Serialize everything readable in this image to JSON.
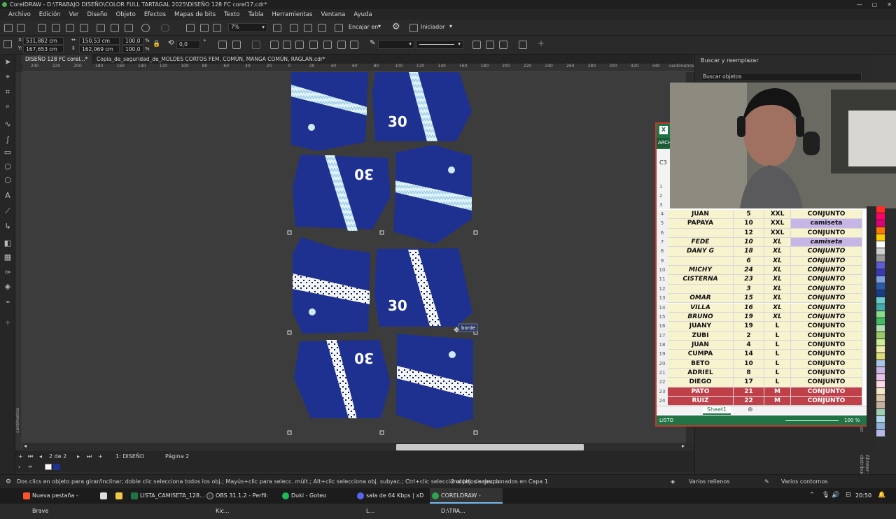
{
  "window": {
    "title": "CorelDRAW - D:\\TRABAJO DISEÑO\\COLOR FULL TARTAGAL 2025\\DISEÑO 128 FC corel17.cdr*"
  },
  "menu": [
    "Archivo",
    "Edición",
    "Ver",
    "Diseño",
    "Objeto",
    "Efectos",
    "Mapas de bits",
    "Texto",
    "Tabla",
    "Herramientas",
    "Ventana",
    "Ayuda"
  ],
  "toolbar": {
    "zoom": "7%",
    "snap": "Encajar en",
    "launcher": "Iniciador"
  },
  "propbar": {
    "x": "531,882 cm",
    "y": "167,653 cm",
    "w": "150,53 cm",
    "h": "162,069 cm",
    "sx": "100,0",
    "sy": "100,0",
    "pct": "%",
    "angle": "0,0"
  },
  "tabs": [
    {
      "label": "DISEÑO 128 FC corel...*"
    },
    {
      "label": "Copia_de_seguridad_de_MOLDES CORTOS FEM, COMÚN, MANGA COMÚN, RAGLAN.cdr*"
    }
  ],
  "ruler": {
    "unit": "centímetros",
    "ticks": [
      "240",
      "220",
      "200",
      "180",
      "160",
      "140",
      "120",
      "100",
      "80",
      "60",
      "40",
      "20",
      "0",
      "20",
      "40",
      "60",
      "80",
      "100",
      "120",
      "140",
      "160",
      "180",
      "200",
      "220",
      "240",
      "260",
      "280",
      "300",
      "320",
      "340"
    ],
    "vunit": "centímetros"
  },
  "canvas": {
    "numbers": [
      "30",
      "30",
      "30",
      "30"
    ],
    "tooltip": "borde"
  },
  "pagenav": {
    "count": "2 de 2",
    "page1": "1: DISEÑO",
    "page2": "Página 2"
  },
  "status": {
    "hint": "Dos clics en objeto para girar/inclinar; doble clic selecciona todos los obj.; Mayús+clic para selecc. múlt.; Alt+clic selecciona obj. subyac.; Ctrl+clic selecciona obj. de grupo",
    "selection": "2 objetos seleccionados en Capa 1",
    "fill": "Varios rellenos",
    "outline": "Varios contornos"
  },
  "docker": {
    "title": "Buscar y reemplazar",
    "search": "Buscar objetos",
    "vtab1": "Transformar",
    "vtab2": "Alinear y distribuir"
  },
  "excel": {
    "file_tab": "ARCH",
    "cell_ref": "C3",
    "sheet": "Sheet1",
    "status": "LISTO",
    "zoom": "100 %",
    "empty_rows": [
      "1",
      "2",
      "3"
    ],
    "rows": [
      {
        "n": "4",
        "name": "JUAN",
        "num": "5",
        "size": "XXL",
        "type": "CONJUNTO",
        "italic": false,
        "hl": ""
      },
      {
        "n": "5",
        "name": "PAPAYA",
        "num": "10",
        "size": "XXL",
        "type": "camiseta",
        "italic": false,
        "hl": "lav"
      },
      {
        "n": "6",
        "name": "",
        "num": "12",
        "size": "XXL",
        "type": "CONJUNTO",
        "italic": false,
        "hl": ""
      },
      {
        "n": "7",
        "name": "FEDE",
        "num": "10",
        "size": "XL",
        "type": "camiseta",
        "italic": true,
        "hl": "lav"
      },
      {
        "n": "8",
        "name": "DANY G",
        "num": "18",
        "size": "XL",
        "type": "CONJUNTO",
        "italic": true,
        "hl": ""
      },
      {
        "n": "9",
        "name": "",
        "num": "6",
        "size": "XL",
        "type": "CONJUNTO",
        "italic": true,
        "hl": ""
      },
      {
        "n": "10",
        "name": "MICHY",
        "num": "24",
        "size": "XL",
        "type": "CONJUNTO",
        "italic": true,
        "hl": ""
      },
      {
        "n": "11",
        "name": "CISTERNA",
        "num": "23",
        "size": "XL",
        "type": "CONJUNTO",
        "italic": true,
        "hl": ""
      },
      {
        "n": "12",
        "name": "",
        "num": "3",
        "size": "XL",
        "type": "CONJUNTO",
        "italic": true,
        "hl": ""
      },
      {
        "n": "13",
        "name": "OMAR",
        "num": "15",
        "size": "XL",
        "type": "CONJUNTO",
        "italic": true,
        "hl": ""
      },
      {
        "n": "14",
        "name": "VILLA",
        "num": "16",
        "size": "XL",
        "type": "CONJUNTO",
        "italic": true,
        "hl": ""
      },
      {
        "n": "15",
        "name": "BRUNO",
        "num": "19",
        "size": "XL",
        "type": "CONJUNTO",
        "italic": true,
        "hl": ""
      },
      {
        "n": "16",
        "name": "JUANY",
        "num": "19",
        "size": "L",
        "type": "CONJUNTO",
        "italic": false,
        "hl": ""
      },
      {
        "n": "17",
        "name": "ZUBI",
        "num": "2",
        "size": "L",
        "type": "CONJUNTO",
        "italic": false,
        "hl": ""
      },
      {
        "n": "18",
        "name": "JUAN",
        "num": "4",
        "size": "L",
        "type": "CONJUNTO",
        "italic": false,
        "hl": ""
      },
      {
        "n": "19",
        "name": "CUMPA",
        "num": "14",
        "size": "L",
        "type": "CONJUNTO",
        "italic": false,
        "hl": ""
      },
      {
        "n": "20",
        "name": "BETO",
        "num": "10",
        "size": "L",
        "type": "CONJUNTO",
        "italic": false,
        "hl": ""
      },
      {
        "n": "21",
        "name": "ADRIEL",
        "num": "8",
        "size": "L",
        "type": "CONJUNTO",
        "italic": false,
        "hl": ""
      },
      {
        "n": "22",
        "name": "DIEGO",
        "num": "17",
        "size": "L",
        "type": "CONJUNTO",
        "italic": false,
        "hl": ""
      },
      {
        "n": "23",
        "name": "PATO",
        "num": "21",
        "size": "M",
        "type": "CONJUNTO",
        "italic": false,
        "hl": "red"
      },
      {
        "n": "24",
        "name": "RUIZ",
        "num": "22",
        "size": "M",
        "type": "CONJUNTO",
        "italic": false,
        "hl": "red"
      }
    ]
  },
  "taskbar": {
    "items": [
      "Nueva pestaña - Brave",
      "LISTA_CAMISETA_128...",
      "OBS 31.1.2 - Perfil: Kic...",
      "Duki - Goteo",
      "sala de 64 Kbps | xD L...",
      "CORELDRAW - D:\\TRA..."
    ],
    "clock": "20:50"
  },
  "colors": {
    "navy": "#1f3190",
    "stripe_light": "#d7eef7",
    "excel_green": "#217346",
    "red_row": "#c0404a",
    "lavender": "#c6b6e6",
    "yellow_cell": "#f7f3cf"
  },
  "palette": [
    "#ff2a2a",
    "#ff0066",
    "#e0007a",
    "#ff7a00",
    "#ffcc00",
    "#ffffff",
    "#cfcfcf",
    "#9a9a9a",
    "#5c5cd6",
    "#3a3ab8",
    "#7fa0e0",
    "#2a5aa8",
    "#1a3a8a",
    "#66cccc",
    "#44aaaa",
    "#88dd88",
    "#44bb66",
    "#b0e0b0",
    "#99cc66",
    "#ccee99",
    "#eeeeaa",
    "#dddd77",
    "#a7c7e7",
    "#c9b6e4",
    "#e6c3e6",
    "#ffd9e6",
    "#f5e6c8",
    "#d9c8a8",
    "#c8b0a0",
    "#9bd0b0",
    "#b0d8e8",
    "#8fb0d8",
    "#b8b8e8"
  ]
}
